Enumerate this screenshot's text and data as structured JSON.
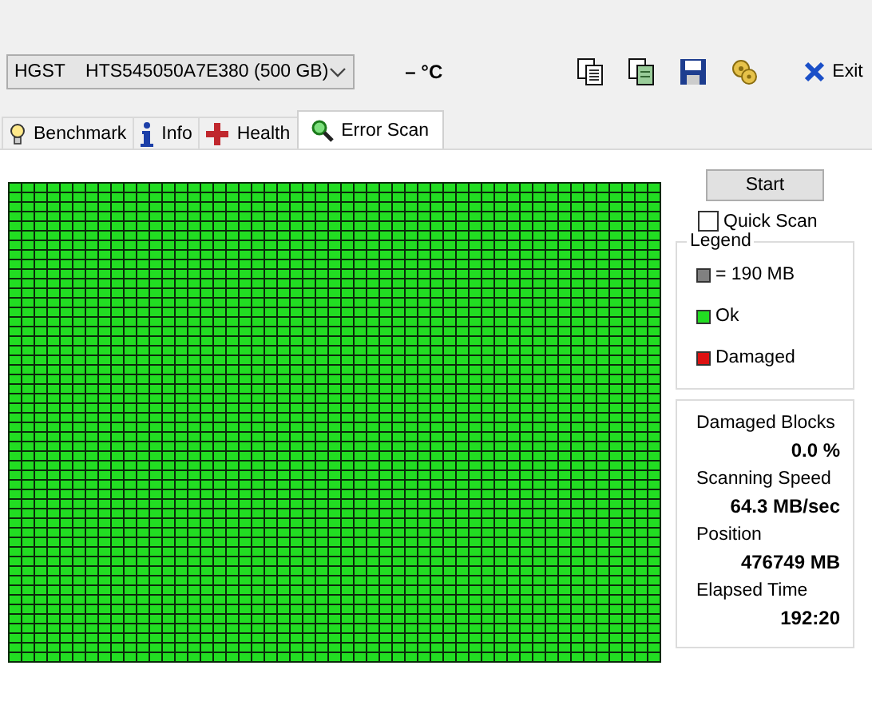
{
  "toolbar": {
    "drive": "HGST    HTS545050A7E380 (500 GB)",
    "temperature": "– °C",
    "exit_label": "Exit"
  },
  "tabs": [
    {
      "label": "Benchmark",
      "selected": false
    },
    {
      "label": "Info",
      "selected": false
    },
    {
      "label": "Health",
      "selected": false
    },
    {
      "label": "Error Scan",
      "selected": true
    }
  ],
  "controls": {
    "start_label": "Start",
    "quick_scan": {
      "label": "Quick Scan",
      "checked": false
    }
  },
  "legend": {
    "title": "Legend",
    "items": [
      {
        "label": "= 190 MB",
        "color": "#808080"
      },
      {
        "label": "Ok",
        "color": "#22dd22"
      },
      {
        "label": "Damaged",
        "color": "#dd1111"
      }
    ]
  },
  "stats": [
    {
      "label": "Damaged Blocks",
      "value": "0.0 %"
    },
    {
      "label": "Scanning Speed",
      "value": "64.3 MB/sec"
    },
    {
      "label": "Position",
      "value": "476749 MB"
    },
    {
      "label": "Elapsed Time",
      "value": "192:20"
    }
  ]
}
